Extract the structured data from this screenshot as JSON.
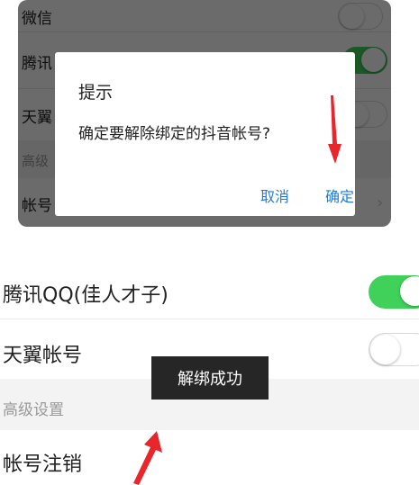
{
  "top_settings": {
    "rows": [
      {
        "label": "微信"
      },
      {
        "label": "腾讯"
      },
      {
        "label": "天翼"
      },
      {
        "label": "帐号"
      }
    ],
    "section_label": "高级"
  },
  "dialog": {
    "title": "提示",
    "message": "确定要解除绑定的抖音帐号?",
    "cancel_label": "取消",
    "ok_label": "确定"
  },
  "bottom_settings": {
    "qq_label": "腾讯QQ(佳人才子)",
    "qq_toggle_on": true,
    "tianyi_label": "天翼帐号",
    "tianyi_toggle_on": false,
    "section_label": "高级设置",
    "cancel_account_label": "帐号注销"
  },
  "toast": {
    "message": "解绑成功"
  },
  "colors": {
    "accent_blue": "#1e7bd7",
    "toggle_green": "#3fd15a",
    "arrow_red": "#e8262b"
  }
}
